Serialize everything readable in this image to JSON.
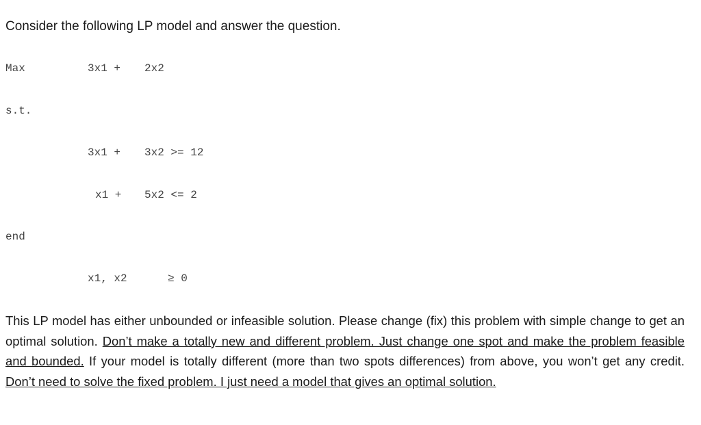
{
  "intro": "Consider the following LP model and answer the question.",
  "model": {
    "objective_label": "Max",
    "objective_terms": [
      "3x1 +",
      "2x2"
    ],
    "st_label": "s.t.",
    "constraints": [
      {
        "lhs1": "3x1 +",
        "rhs_part": "3x2 >= 12"
      },
      {
        "lhs1": "x1 +",
        "rhs_part": "5x2 <= 2"
      }
    ],
    "end_label": "end",
    "nonneg_vars": "x1, x2",
    "nonneg_rel": "≥ 0"
  },
  "paragraph": {
    "s1": "This LP model has either unbounded or infeasible solution. Please change (fix) this problem with simple change to get an optimal solution. ",
    "u1": "Don’t make a totally new and different problem. Just change one spot and make the problem feasible and bounded.",
    "s2": " If your model is totally different (more than two spots differences) from above, you won’t get any credit. ",
    "u2": "Don’t need to solve the fixed problem. I just need a model that gives an optimal solution."
  }
}
